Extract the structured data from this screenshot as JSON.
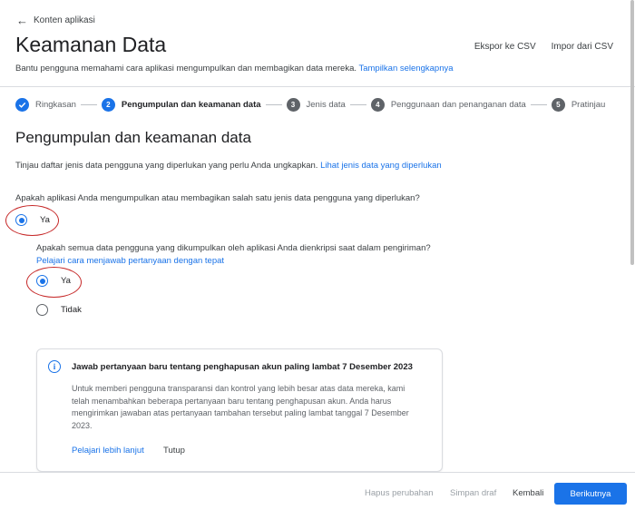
{
  "header": {
    "back_label": "Konten aplikasi",
    "title": "Keamanan Data",
    "export_csv": "Ekspor ke CSV",
    "import_csv": "Impor dari CSV",
    "subtitle": "Bantu pengguna memahami cara aplikasi mengumpulkan dan membagikan data mereka.",
    "subtitle_link": "Tampilkan selengkapnya"
  },
  "stepper": {
    "steps": [
      {
        "number": "",
        "label": "Ringkasan",
        "state": "done"
      },
      {
        "number": "2",
        "label": "Pengumpulan dan keamanan data",
        "state": "active"
      },
      {
        "number": "3",
        "label": "Jenis data",
        "state": "pending"
      },
      {
        "number": "4",
        "label": "Penggunaan dan penanganan data",
        "state": "pending"
      },
      {
        "number": "5",
        "label": "Pratinjau",
        "state": "pending"
      }
    ]
  },
  "main": {
    "section_title": "Pengumpulan dan keamanan data",
    "intro": "Tinjau daftar jenis data pengguna yang diperlukan yang perlu Anda ungkapkan.",
    "intro_link": "Lihat jenis data yang diperlukan",
    "question1": "Apakah aplikasi Anda mengumpulkan atau membagikan salah satu jenis data pengguna yang diperlukan?",
    "q1_option_yes": "Ya",
    "question2": "Apakah semua data pengguna yang dikumpulkan oleh aplikasi Anda dienkripsi saat dalam pengiriman?",
    "q2_link": "Pelajari cara menjawab pertanyaan dengan tepat",
    "q2_option_yes": "Ya",
    "q2_option_no": "Tidak"
  },
  "notice": {
    "title": "Jawab pertanyaan baru tentang penghapusan akun paling lambat 7 Desember 2023",
    "body": "Untuk memberi pengguna transparansi dan kontrol yang lebih besar atas data mereka, kami telah menambahkan beberapa pertanyaan baru tentang penghapusan akun. Anda harus mengirimkan jawaban atas pertanyaan tambahan tersebut paling lambat tanggal 7 Desember 2023.",
    "learn_more": "Pelajari lebih lanjut",
    "close": "Tutup"
  },
  "footer": {
    "discard": "Hapus perubahan",
    "save_draft": "Simpan draf",
    "back": "Kembali",
    "next": "Berikutnya"
  },
  "colors": {
    "accent": "#1a73e8",
    "annotation": "#c62828"
  }
}
